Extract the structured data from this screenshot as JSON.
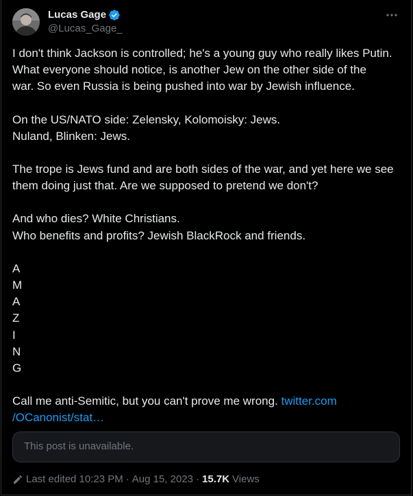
{
  "author": {
    "display_name": "Lucas Gage",
    "handle": "@Lucas_Gage_",
    "verified": true,
    "verified_color": "#1d9bf0"
  },
  "menu_icon": "more-horizontal-icon",
  "post": {
    "paragraphs": [
      [
        "I don't think Jackson is controlled; he's a young guy who really likes Putin.",
        "What everyone should notice, is another Jew on the other side of the",
        "war. So even Russia is being pushed into war by Jewish influence."
      ],
      [
        "On the US/NATO side: Zelensky, Kolomoisky: Jews.",
        "Nuland, Blinken: Jews."
      ],
      [
        "The trope is Jews fund and are both sides of the war, and yet here we see",
        "them doing just that. Are we supposed to pretend we don't?"
      ],
      [
        "And who dies? White Christians.",
        "Who benefits and profits? Jewish BlackRock and friends."
      ]
    ],
    "letters": [
      "A",
      "M",
      "A",
      "Z",
      "I",
      "N",
      "G"
    ],
    "closing_text": "Call me anti-Semitic, but you can't prove me wrong.",
    "link_line1": "twitter.com",
    "link_line2": "/OCanonist/stat…"
  },
  "quoted_post": {
    "unavailable_text": "This post is unavailable."
  },
  "meta": {
    "edit_icon": "pencil-icon",
    "edited_label": "Last edited 10:23 PM",
    "separator": "·",
    "date": "Aug 15, 2023",
    "views_count": "15.7K",
    "views_label": "Views"
  },
  "colors": {
    "background": "#000000",
    "text": "#e7e9ea",
    "muted": "#71767b",
    "link": "#1d9bf0",
    "border": "#2f3336"
  }
}
